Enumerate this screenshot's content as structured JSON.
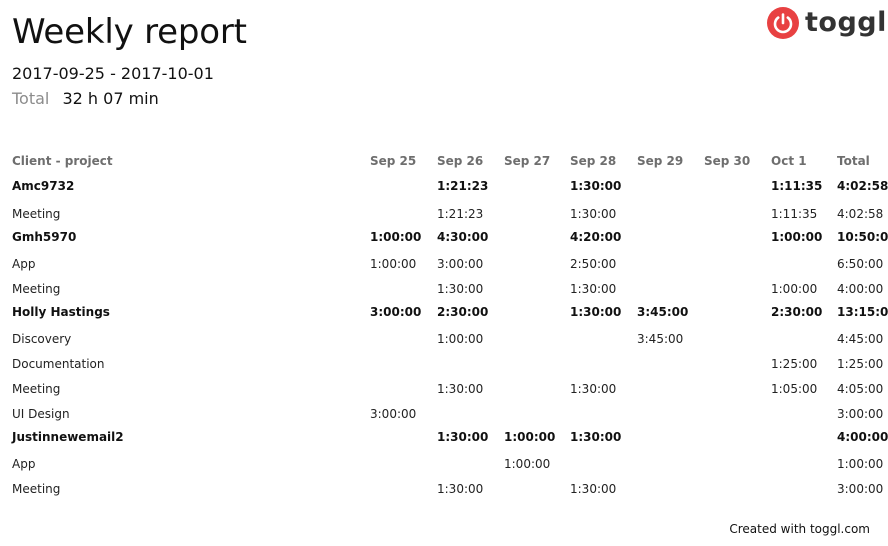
{
  "report": {
    "title": "Weekly report",
    "date_range": "2017-09-25  -  2017-10-01",
    "total_label": "Total",
    "total_value": "32 h 07 min"
  },
  "logo": {
    "text": "toggl",
    "icon": "power-icon",
    "brand_color": "#e84142"
  },
  "table": {
    "headers": [
      "Client - project",
      "Sep 25",
      "Sep 26",
      "Sep 27",
      "Sep 28",
      "Sep 29",
      "Sep 30",
      "Oct 1",
      "Total"
    ],
    "rows": [
      {
        "kind": "client",
        "cells": [
          "Amc9732",
          "",
          "1:21:23",
          "",
          "1:30:00",
          "",
          "",
          "1:11:35",
          "4:02:58"
        ]
      },
      {
        "kind": "project",
        "cells": [
          "Meeting",
          "",
          "1:21:23",
          "",
          "1:30:00",
          "",
          "",
          "1:11:35",
          "4:02:58"
        ]
      },
      {
        "kind": "client",
        "cells": [
          "Gmh5970",
          "1:00:00",
          "4:30:00",
          "",
          "4:20:00",
          "",
          "",
          "1:00:00",
          "10:50:00"
        ]
      },
      {
        "kind": "project",
        "cells": [
          "App",
          "1:00:00",
          "3:00:00",
          "",
          "2:50:00",
          "",
          "",
          "",
          "6:50:00"
        ]
      },
      {
        "kind": "project",
        "cells": [
          "Meeting",
          "",
          "1:30:00",
          "",
          "1:30:00",
          "",
          "",
          "1:00:00",
          "4:00:00"
        ]
      },
      {
        "kind": "client",
        "cells": [
          "Holly Hastings",
          "3:00:00",
          "2:30:00",
          "",
          "1:30:00",
          "3:45:00",
          "",
          "2:30:00",
          "13:15:00"
        ]
      },
      {
        "kind": "project",
        "cells": [
          "Discovery",
          "",
          "1:00:00",
          "",
          "",
          "3:45:00",
          "",
          "",
          "4:45:00"
        ]
      },
      {
        "kind": "project",
        "cells": [
          "Documentation",
          "",
          "",
          "",
          "",
          "",
          "",
          "1:25:00",
          "1:25:00"
        ]
      },
      {
        "kind": "project",
        "cells": [
          "Meeting",
          "",
          "1:30:00",
          "",
          "1:30:00",
          "",
          "",
          "1:05:00",
          "4:05:00"
        ]
      },
      {
        "kind": "project",
        "cells": [
          "UI Design",
          "3:00:00",
          "",
          "",
          "",
          "",
          "",
          "",
          "3:00:00"
        ]
      },
      {
        "kind": "client",
        "cells": [
          "Justinnewemail2",
          "",
          "1:30:00",
          "1:00:00",
          "1:30:00",
          "",
          "",
          "",
          "4:00:00"
        ]
      },
      {
        "kind": "project",
        "cells": [
          "App",
          "",
          "",
          "1:00:00",
          "",
          "",
          "",
          "",
          "1:00:00"
        ]
      },
      {
        "kind": "project",
        "cells": [
          "Meeting",
          "",
          "1:30:00",
          "",
          "1:30:00",
          "",
          "",
          "",
          "3:00:00"
        ]
      }
    ]
  },
  "footer": {
    "text": "Created with toggl.com"
  }
}
